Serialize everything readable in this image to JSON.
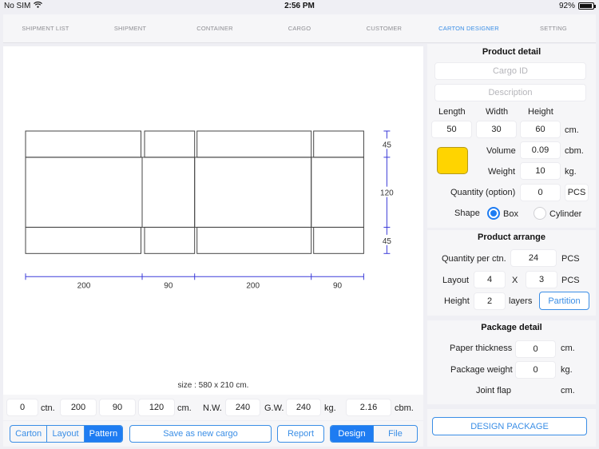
{
  "status_bar": {
    "carrier": "No SIM",
    "wifi_icon": "wifi-icon",
    "time": "2:56 PM",
    "battery_percent": "92%",
    "battery_level": 0.92
  },
  "nav": {
    "tabs": [
      {
        "label": "SHIPMENT LIST",
        "active": false
      },
      {
        "label": "SHIPMENT",
        "active": false
      },
      {
        "label": "CONTAINER",
        "active": false
      },
      {
        "label": "CARGO",
        "active": false
      },
      {
        "label": "CUSTOMER",
        "active": false
      },
      {
        "label": "CARTON DESIGNER",
        "active": true
      },
      {
        "label": "SETTING",
        "active": false
      }
    ]
  },
  "pattern": {
    "widths": [
      200,
      90,
      200,
      90
    ],
    "width_labels": [
      "200",
      "90",
      "200",
      "90"
    ],
    "heights": [
      45,
      120,
      45
    ],
    "height_labels": [
      "45",
      "120",
      "45"
    ],
    "size_text": "size : 580 x 210 cm.",
    "line_color": "#444444",
    "dimension_color": "#3b3bd9"
  },
  "summary": {
    "cartons": "0",
    "cartons_unit": "ctn.",
    "length": "200",
    "width": "90",
    "height": "120",
    "dim_unit": "cm.",
    "nw_label": "N.W.",
    "nw": "240",
    "gw_label": "G.W.",
    "gw": "240",
    "weight_unit": "kg.",
    "volume": "2.16",
    "volume_unit": "cbm."
  },
  "toolbar": {
    "view_segments": [
      {
        "label": "Carton",
        "selected": false
      },
      {
        "label": "Layout",
        "selected": false
      },
      {
        "label": "Pattern",
        "selected": true
      }
    ],
    "save_label": "Save as new cargo",
    "report_label": "Report",
    "mode_segments": [
      {
        "label": "Design",
        "selected": true
      },
      {
        "label": "File",
        "selected": false
      }
    ]
  },
  "product_detail": {
    "title": "Product detail",
    "cargo_id_placeholder": "Cargo ID",
    "description_placeholder": "Description",
    "length_label": "Length",
    "width_label": "Width",
    "height_label": "Height",
    "length": "50",
    "width": "30",
    "height": "60",
    "dim_unit": "cm.",
    "color": "#ffd400",
    "volume_label": "Volume",
    "volume": "0.09",
    "volume_unit": "cbm.",
    "weight_label": "Weight",
    "weight": "10",
    "weight_unit": "kg.",
    "quantity_label": "Quantity (option)",
    "quantity": "0",
    "quantity_unit": "PCS",
    "shape_label": "Shape",
    "shape_options": [
      {
        "label": "Box",
        "selected": true
      },
      {
        "label": "Cylinder",
        "selected": false
      }
    ]
  },
  "product_arrange": {
    "title": "Product arrange",
    "qty_per_ctn_label": "Quantity per ctn.",
    "qty_per_ctn": "24",
    "qty_unit": "PCS",
    "layout_label": "Layout",
    "layout_x": "4",
    "layout_sep": "X",
    "layout_y": "3",
    "layout_unit": "PCS",
    "height_label": "Height",
    "height_layers": "2",
    "layers_unit": "layers",
    "partition_label": "Partition"
  },
  "package_detail": {
    "title": "Package detail",
    "paper_thickness_label": "Paper thickness",
    "paper_thickness": "0",
    "paper_unit": "cm.",
    "package_weight_label": "Package weight",
    "package_weight": "0",
    "package_weight_unit": "kg.",
    "joint_flap_label": "Joint flap",
    "joint_flap_unit": "cm."
  },
  "design_package_label": "DESIGN PACKAGE"
}
